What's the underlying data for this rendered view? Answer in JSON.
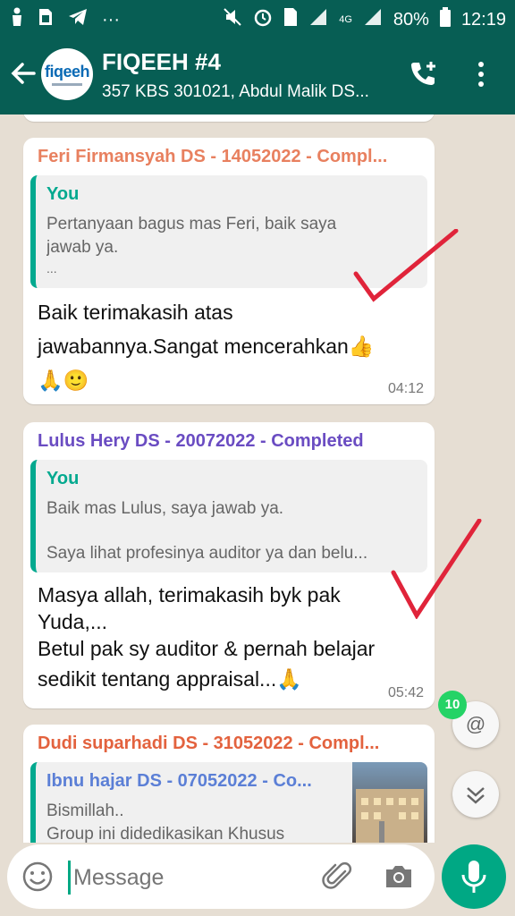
{
  "statusbar": {
    "battery": "80%",
    "time": "12:19",
    "network": "4G",
    "notification_dots": "···"
  },
  "header": {
    "avatar_logo": "fiqeeh",
    "title": "FIQEEH #4",
    "subtitle": "357 KBS 301021, Abdul Malik DS..."
  },
  "messages": [
    {
      "sender": "Feri Firmansyah DS - 14052022 - Compl...",
      "sender_color": "#e8805f",
      "quote_author": "You",
      "quote_line1": "Pertanyaan bagus mas Feri, baik saya",
      "quote_line2": "jawab ya.",
      "quote_line3": "...",
      "line1": "Baik terimakasih atas",
      "line2": "jawabannya.Sangat mencerahkan👍",
      "line3": "🙏🙂",
      "time": "04:12"
    },
    {
      "sender": "Lulus Hery DS - 20072022 - Completed",
      "sender_color": "#6a4cc2",
      "quote_author": "You",
      "quote_line1": "Baik mas Lulus, saya jawab ya.",
      "quote_line2": "Saya lihat profesinya auditor ya dan belu...",
      "line1": "Masya allah, terimakasih byk pak",
      "line2": "Yuda,...",
      "line3": "Betul pak sy auditor & pernah belajar",
      "line4": "sedikit tentang appraisal...🙏",
      "time": "05:42"
    },
    {
      "sender": "Dudi suparhadi DS - 31052022 - Compl...",
      "sender_color": "#e3623e",
      "quote_author": "Ibnu hajar DS - 07052022 - Co...",
      "quote_author_color": "#5b7fd6",
      "quote_line1": "Bismillah..",
      "quote_line2": "Group ini didedikasikan Khusus"
    }
  ],
  "unread_badge": "10",
  "mention_fab": "@",
  "input": {
    "placeholder": "Message"
  },
  "colors": {
    "header_bg": "#075e54",
    "chat_bg": "#e6ded3",
    "accent": "#00a884"
  }
}
